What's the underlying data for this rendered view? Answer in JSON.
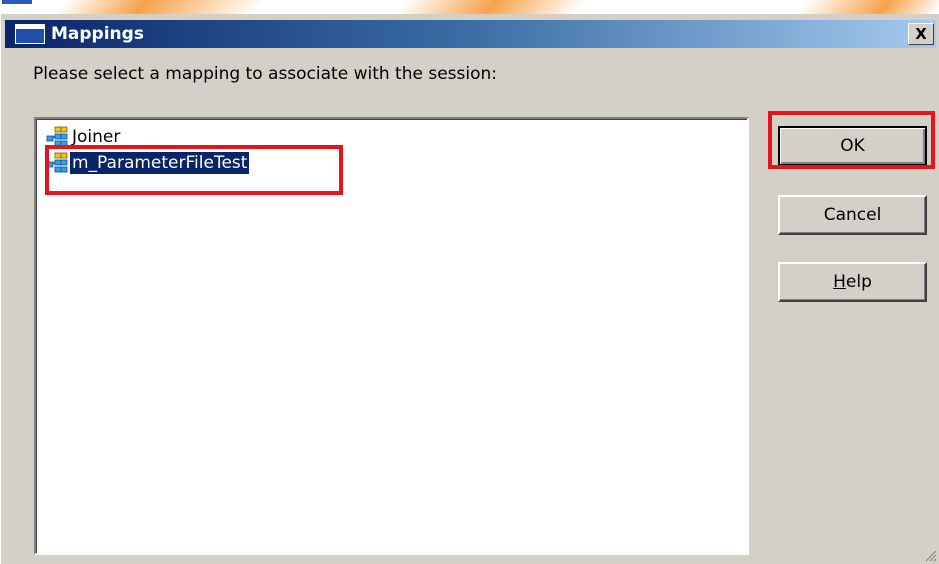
{
  "window": {
    "title": "Mappings",
    "close_symbol": "X"
  },
  "prompt": "Please select a mapping to associate with the session:",
  "mappings": [
    {
      "label": "Joiner",
      "icon": "mapping-icon",
      "selected": false
    },
    {
      "label": "m_ParameterFileTest",
      "icon": "mapping-icon",
      "selected": true
    }
  ],
  "buttons": {
    "ok": "OK",
    "cancel": "Cancel",
    "help_mnemonic": "H",
    "help_rest": "elp"
  },
  "colors": {
    "highlight": "#e8141c",
    "selection": "#0a246a",
    "dialog": "#d4d0c8"
  }
}
